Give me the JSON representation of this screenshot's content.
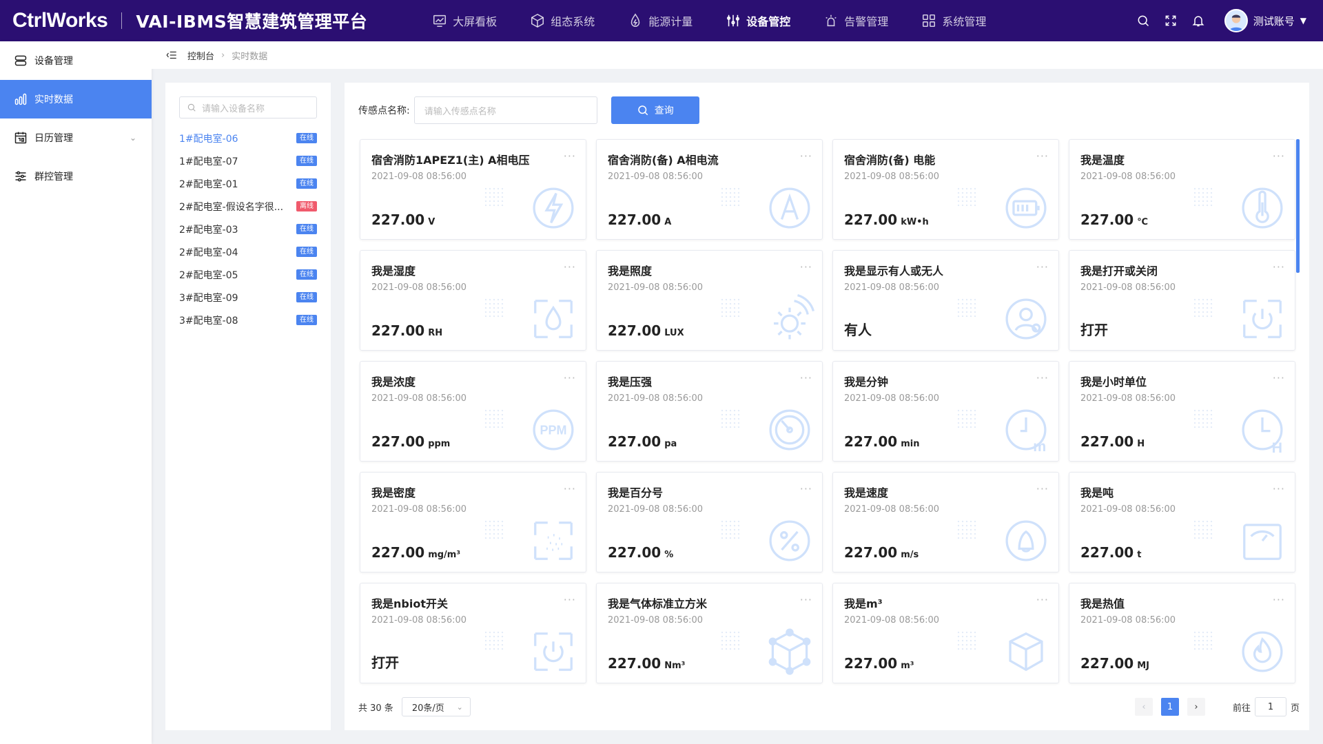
{
  "header": {
    "logo": "CtrlWorks",
    "platform": "VAI-IBMS智慧建筑管理平台",
    "nav": [
      {
        "label": "大屏看板",
        "icon": "chart-monitor-icon"
      },
      {
        "label": "组态系统",
        "icon": "cube-icon"
      },
      {
        "label": "能源计量",
        "icon": "energy-drop-icon"
      },
      {
        "label": "设备管控",
        "icon": "sliders-icon"
      },
      {
        "label": "告警管理",
        "icon": "alarm-icon"
      },
      {
        "label": "系统管理",
        "icon": "grid-icon"
      }
    ],
    "active_nav": 3,
    "user_name": "测试账号"
  },
  "sidebar": {
    "items": [
      {
        "label": "设备管理",
        "icon": "server-icon"
      },
      {
        "label": "实时数据",
        "icon": "bar-chart-icon"
      },
      {
        "label": "日历管理",
        "icon": "calendar-icon"
      },
      {
        "label": "群控管理",
        "icon": "sliders-icon"
      }
    ],
    "active": 1
  },
  "breadcrumb": {
    "parent": "控制台",
    "current": "实时数据"
  },
  "device_panel": {
    "search_placeholder": "请输入设备名称",
    "devices": [
      {
        "name": "1#配电室-06",
        "status": "在线",
        "online": true
      },
      {
        "name": "1#配电室-07",
        "status": "在线",
        "online": true
      },
      {
        "name": "2#配电室-01",
        "status": "在线",
        "online": true
      },
      {
        "name": "2#配电室-假设名字很...",
        "status": "离线",
        "online": false
      },
      {
        "name": "2#配电室-03",
        "status": "在线",
        "online": true
      },
      {
        "name": "2#配电室-04",
        "status": "在线",
        "online": true
      },
      {
        "name": "2#配电室-05",
        "status": "在线",
        "online": true
      },
      {
        "name": "3#配电室-09",
        "status": "在线",
        "online": true
      },
      {
        "name": "3#配电室-08",
        "status": "在线",
        "online": true
      }
    ],
    "active": 0
  },
  "filter": {
    "label": "传感点名称:",
    "placeholder": "请输入传感点名称",
    "query_label": "查询"
  },
  "cards": [
    {
      "title": "宿舍消防1APEZ1(主) A相电压",
      "time": "2021-09-08 08:56:00",
      "value": "227.00",
      "unit": "V",
      "icon": "lightning-icon"
    },
    {
      "title": "宿舍消防(备) A相电流",
      "time": "2021-09-08 08:56:00",
      "value": "227.00",
      "unit": "A",
      "icon": "ampere-icon"
    },
    {
      "title": "宿舍消防(备) 电能",
      "time": "2021-09-08 08:56:00",
      "value": "227.00",
      "unit": "kW•h",
      "icon": "battery-icon"
    },
    {
      "title": "我是温度",
      "time": "2021-09-08 08:56:00",
      "value": "227.00",
      "unit": "℃",
      "icon": "thermometer-icon"
    },
    {
      "title": "我是湿度",
      "time": "2021-09-08 08:56:00",
      "value": "227.00",
      "unit": "RH",
      "icon": "humidity-icon"
    },
    {
      "title": "我是照度",
      "time": "2021-09-08 08:56:00",
      "value": "227.00",
      "unit": "LUX",
      "icon": "sun-icon"
    },
    {
      "title": "我是显示有人或无人",
      "time": "2021-09-08 08:56:00",
      "value": "有人",
      "unit": "",
      "icon": "person-icon"
    },
    {
      "title": "我是打开或关闭",
      "time": "2021-09-08 08:56:00",
      "value": "打开",
      "unit": "",
      "icon": "power-icon"
    },
    {
      "title": "我是浓度",
      "time": "2021-09-08 08:56:00",
      "value": "227.00",
      "unit": "ppm",
      "icon": "ppm-icon"
    },
    {
      "title": "我是压强",
      "time": "2021-09-08 08:56:00",
      "value": "227.00",
      "unit": "pa",
      "icon": "gauge-icon"
    },
    {
      "title": "我是分钟",
      "time": "2021-09-08 08:56:00",
      "value": "227.00",
      "unit": "min",
      "icon": "clock-minute-icon"
    },
    {
      "title": "我是小时单位",
      "time": "2021-09-08 08:56:00",
      "value": "227.00",
      "unit": "H",
      "icon": "clock-hour-icon"
    },
    {
      "title": "我是密度",
      "time": "2021-09-08 08:56:00",
      "value": "227.00",
      "unit": "mg/m³",
      "icon": "density-icon"
    },
    {
      "title": "我是百分号",
      "time": "2021-09-08 08:56:00",
      "value": "227.00",
      "unit": "%",
      "icon": "percent-icon"
    },
    {
      "title": "我是速度",
      "time": "2021-09-08 08:56:00",
      "value": "227.00",
      "unit": "m/s",
      "icon": "speed-icon"
    },
    {
      "title": "我是吨",
      "time": "2021-09-08 08:56:00",
      "value": "227.00",
      "unit": "t",
      "icon": "scale-icon"
    },
    {
      "title": "我是nbiot开关",
      "time": "2021-09-08 08:56:00",
      "value": "打开",
      "unit": "",
      "icon": "power-icon"
    },
    {
      "title": "我是气体标准立方米",
      "time": "2021-09-08 08:56:00",
      "value": "227.00",
      "unit": "Nm³",
      "icon": "gas-cube-icon"
    },
    {
      "title": "我是m³",
      "time": "2021-09-08 08:56:00",
      "value": "227.00",
      "unit": "m³",
      "icon": "cube-icon"
    },
    {
      "title": "我是热值",
      "time": "2021-09-08 08:56:00",
      "value": "227.00",
      "unit": "MJ",
      "icon": "flame-icon"
    }
  ],
  "pagination": {
    "total": "共 30 条",
    "page_size": "20条/页",
    "current_page": "1",
    "goto_label": "前往",
    "goto_value": "1",
    "page_suffix": "页"
  },
  "colors": {
    "header_bg": "#2b0f72",
    "accent": "#4b84f0",
    "offline": "#f05a6c"
  }
}
